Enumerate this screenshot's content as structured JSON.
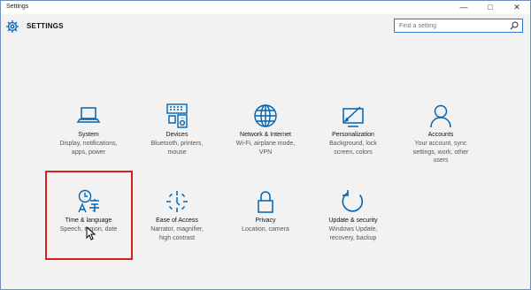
{
  "window": {
    "title": "Settings",
    "controls": {
      "minimize": "—",
      "maximize": "□",
      "close": "✕"
    }
  },
  "header": {
    "title": "SETTINGS",
    "icon": "gear-icon"
  },
  "search": {
    "placeholder": "Find a setting",
    "icon": "search-icon"
  },
  "tiles": [
    {
      "name": "System",
      "desc": [
        "Display, notifications,",
        "apps, power"
      ],
      "icon": "laptop-icon"
    },
    {
      "name": "Devices",
      "desc": [
        "Bluetooth, printers,",
        "mouse"
      ],
      "icon": "devices-icon"
    },
    {
      "name": "Network & Internet",
      "desc": [
        "Wi-Fi, airplane mode,",
        "VPN"
      ],
      "icon": "globe-icon"
    },
    {
      "name": "Personalization",
      "desc": [
        "Background, lock",
        "screen, colors"
      ],
      "icon": "personalization-icon"
    },
    {
      "name": "Accounts",
      "desc": [
        "Your account, sync",
        "settings, work, other",
        "users"
      ],
      "icon": "person-icon"
    },
    {
      "name": "Time & language",
      "desc": [
        "Speech, region, date"
      ],
      "icon": "time-language-icon"
    },
    {
      "name": "Ease of Access",
      "desc": [
        "Narrator, magnifier,",
        "high contrast"
      ],
      "icon": "ease-of-access-icon"
    },
    {
      "name": "Privacy",
      "desc": [
        "Location, camera"
      ],
      "icon": "lock-icon"
    },
    {
      "name": "Update & security",
      "desc": [
        "Windows Update,",
        "recovery, backup"
      ],
      "icon": "update-icon"
    }
  ],
  "colors": {
    "accent": "#0063b1",
    "highlight": "#d62020",
    "search_border": "#2a78c8"
  }
}
